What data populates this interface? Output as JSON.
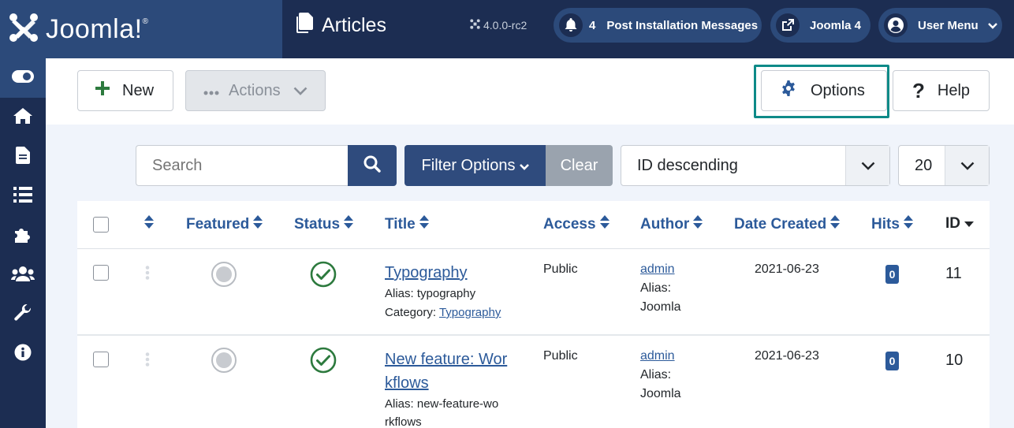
{
  "header": {
    "logo_text": "Joomla!",
    "page_title": "Articles",
    "version": "4.0.0-rc2",
    "post_install_count": "4",
    "post_install_label": "Post Installation Messages",
    "joomla4_label": "Joomla 4",
    "user_menu_label": "User Menu"
  },
  "sidebar": {
    "items": [
      "toggle-menu",
      "home",
      "content",
      "menus",
      "components",
      "users",
      "system",
      "help"
    ]
  },
  "toolbar": {
    "new_label": "New",
    "actions_label": "Actions",
    "options_label": "Options",
    "help_label": "Help"
  },
  "filters": {
    "search_placeholder": "Search",
    "filter_options_label": "Filter Options",
    "clear_label": "Clear",
    "ordering_value": "ID descending",
    "limit_value": "20"
  },
  "table": {
    "columns": {
      "featured": "Featured",
      "status": "Status",
      "title": "Title",
      "access": "Access",
      "author": "Author",
      "date_created": "Date Created",
      "hits": "Hits",
      "id": "ID"
    },
    "rows": [
      {
        "title": "Typography",
        "alias": "Alias: typography",
        "category_label": "Category:",
        "category": "Typography",
        "access": "Public",
        "author": "admin",
        "author_alias_label": "Alias:",
        "author_alias": "Joomla",
        "date_created": "2021-06-23",
        "hits": "0",
        "id": "11"
      },
      {
        "title_line1": "New feature: Wor",
        "title_line2": "kflows",
        "alias_line1": "Alias: new-feature-wo",
        "alias_line2": "rkflows",
        "access": "Public",
        "author": "admin",
        "author_alias_label": "Alias:",
        "author_alias": "Joomla",
        "date_created": "2021-06-23",
        "hits": "0",
        "id": "10"
      }
    ]
  },
  "colors": {
    "header_bg": "#1c2d52",
    "logo_bg": "#2c4a7a",
    "link": "#2c5a9a",
    "options_highlight": "#0e8a88",
    "published_green": "#2d7a3e"
  }
}
